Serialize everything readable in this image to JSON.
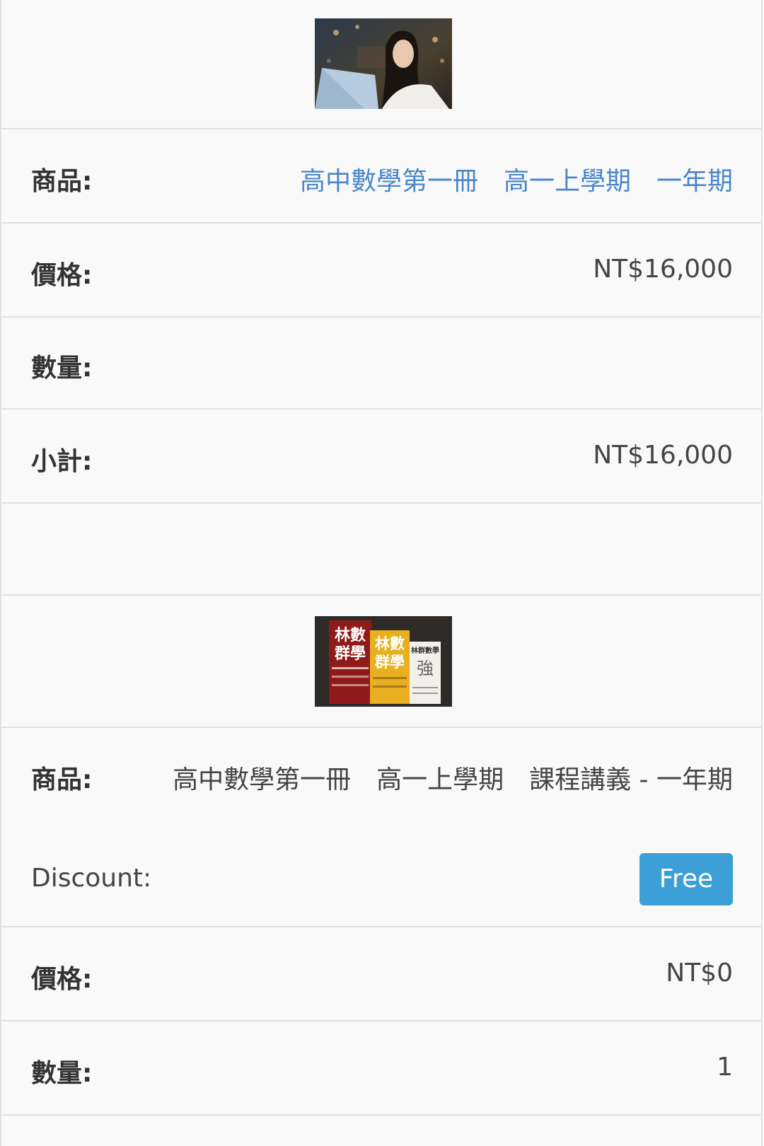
{
  "items": [
    {
      "image_name": "student-laptop-photo",
      "product_label": "商品:",
      "product_name": "高中數學第一冊　高一上學期　一年期",
      "price_label": "價格:",
      "price": "NT$16,000",
      "quantity_label": "數量:",
      "quantity": "",
      "subtotal_label": "小計:",
      "subtotal": "NT$16,000"
    },
    {
      "image_name": "textbooks-photo",
      "image_text": [
        "林數",
        "群學",
        "林數",
        "群學",
        "林群數學",
        "強"
      ],
      "product_label": "商品:",
      "product_name": "高中數學第一冊　高一上學期　課程講義 - 一年期",
      "discount_label": "Discount:",
      "discount_badge": "Free",
      "price_label": "價格:",
      "price": "NT$0",
      "quantity_label": "數量:",
      "quantity": "1"
    }
  ],
  "colors": {
    "link": "#4a86c8",
    "badge": "#3d9fd8",
    "border": "#e0e0e0",
    "background": "#f9f9f9"
  }
}
